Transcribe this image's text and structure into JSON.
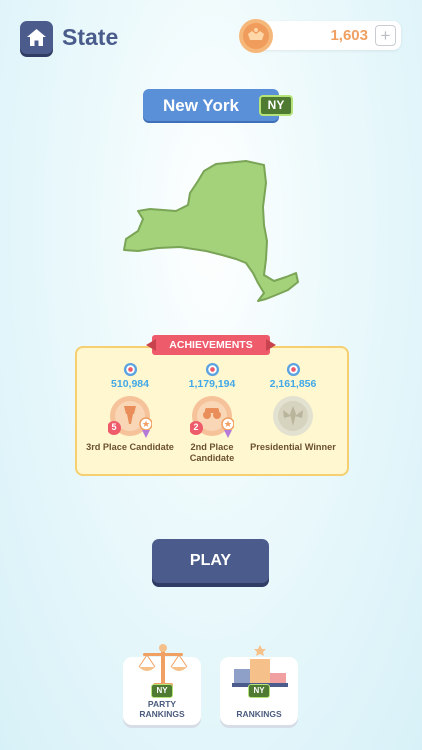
{
  "header": {
    "title": "State",
    "coins": "1,603",
    "plus_label": "+"
  },
  "state": {
    "name": "New York",
    "code": "NY",
    "map_color": "#a3d27b"
  },
  "achievements": {
    "title": "ACHIEVEMENTS",
    "items": [
      {
        "count": "510,984",
        "label": "3rd Place Candidate",
        "rank": "5",
        "icon": "bronze-medal-icon"
      },
      {
        "count": "1,179,194",
        "label": "2nd Place Candidate",
        "rank": "2",
        "icon": "silver-medal-icon"
      },
      {
        "count": "2,161,856",
        "label": "Presidential Winner",
        "rank": "",
        "icon": "gold-medal-icon"
      }
    ]
  },
  "play_label": "PLAY",
  "cards": [
    {
      "label": "PARTY RANKINGS",
      "badge": "NY",
      "icon": "scales-icon"
    },
    {
      "label": "RANKINGS",
      "badge": "NY",
      "icon": "podium-icon"
    }
  ],
  "colors": {
    "primary": "#4b5c8c",
    "accent_blue": "#5a90d8",
    "coin_orange": "#f0a062",
    "ribbon_red": "#ee5b6b"
  }
}
